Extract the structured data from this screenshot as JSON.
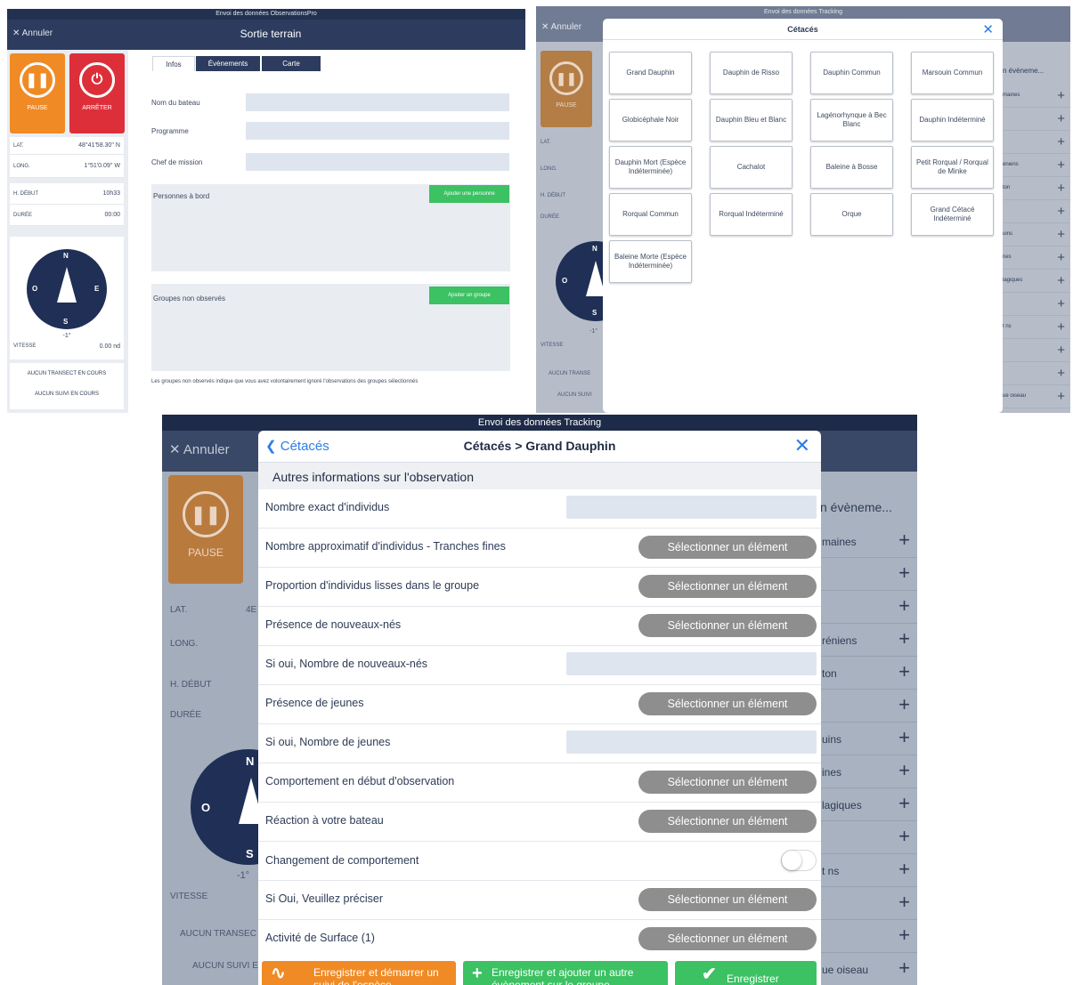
{
  "shot1": {
    "topbar": "Envoi des données ObservationsPro",
    "cancel": "Annuler",
    "title": "Sortie terrain",
    "pause": "PAUSE",
    "stop": "ARRÊTER",
    "info": [
      {
        "k": "LAT.",
        "v": "48°41'58.30'' N"
      },
      {
        "k": "LONG.",
        "v": "1°51'0.09'' W"
      },
      {
        "k": "H. DÉBUT",
        "v": "10h33"
      },
      {
        "k": "DURÉE",
        "v": "00:00"
      }
    ],
    "compass": {
      "n": "N",
      "o": "O",
      "e": "E",
      "s": "S",
      "heading": "-1°"
    },
    "speed": {
      "k": "VITESSE",
      "v": "0.00 nd"
    },
    "transect": "AUCUN TRANSECT EN COURS",
    "suivi": "AUCUN SUIVI EN COURS",
    "tabs": [
      "Infos",
      "Évènements",
      "Carte"
    ],
    "fields": [
      "Nom du bateau",
      "Programme",
      "Chef de mission"
    ],
    "persons": "Personnes à bord",
    "add_person": "Ajouter une personne",
    "groups": "Groupes non observés",
    "add_group": "Ajouter un groupe",
    "note": "Les groupes non observés indique que vous avez volontairement ignoré l'observations des groupes sélectionnés"
  },
  "shot2": {
    "topbar": "Envoi des données Tracking",
    "cancel": "Annuler",
    "pause": "PAUSE",
    "left_labels": [
      "LAT.",
      "LONG.",
      "H. DÉBUT",
      "DURÉE"
    ],
    "speed": "VITESSE",
    "transect": "AUCUN TRANSE",
    "suivi": "AUCUN SUIVI",
    "heading": "-1°",
    "n": "N",
    "o": "O",
    "s": "S",
    "modal_title": "Cétacés",
    "cells": [
      "Grand Dauphin",
      "Dauphin de Risso",
      "Dauphin Commun",
      "Marsouin Commun",
      "Globicéphale Noir",
      "Dauphin Bleu et Blanc",
      "Lagénorhynque à Bec Blanc",
      "Dauphin Indéterminé",
      "Dauphin Mort (Espèce Indéterminée)",
      "Cachalot",
      "Baleine à Bosse",
      "Petit Rorqual / Rorqual de Minke",
      "Rorqual Commun",
      "Rorqual Indéterminé",
      "Orque",
      "Grand Cétacé Indéterminé",
      "Baleine Morte (Espèce Indéterminée)"
    ],
    "right_header": "n évèneme...",
    "right_items": [
      "maines",
      "",
      "",
      "éniens",
      "ton",
      "",
      "uins",
      "nes",
      "lagiques",
      "",
      "t ns",
      "",
      "",
      "ue oiseau"
    ]
  },
  "shot3": {
    "topbar": "Envoi des données Tracking",
    "cancel": "Annuler",
    "pause": "PAUSE",
    "left_labels": [
      "LAT.",
      "LONG.",
      "H. DÉBUT",
      "DURÉE"
    ],
    "lat_partial": "4E",
    "heading": "-1°",
    "n": "N",
    "o": "O",
    "s": "S",
    "speed": "VITESSE",
    "transect": "AUCUN TRANSEC",
    "suivi": "AUCUN SUIVI E",
    "back": "Cétacés",
    "title": "Cétacés > Grand Dauphin",
    "section": "Autres informations sur l'observation",
    "select_label": "Sélectionner un élément",
    "rows": [
      {
        "label": "Nombre exact d'individus",
        "type": "input"
      },
      {
        "label": "Nombre approximatif d'individus - Tranches fines",
        "type": "select"
      },
      {
        "label": "Proportion d'individus lisses dans le groupe",
        "type": "select"
      },
      {
        "label": "Présence de nouveaux-nés",
        "type": "select"
      },
      {
        "label": "Si oui, Nombre de nouveaux-nés",
        "type": "input"
      },
      {
        "label": "Présence de jeunes",
        "type": "select"
      },
      {
        "label": "Si oui, Nombre de jeunes",
        "type": "input"
      },
      {
        "label": "Comportement en début d'observation",
        "type": "select"
      },
      {
        "label": "Réaction à votre bateau",
        "type": "select"
      },
      {
        "label": "Changement de comportement",
        "type": "toggle"
      },
      {
        "label": "Si Oui, Veuillez préciser",
        "type": "select"
      },
      {
        "label": "Activité de Surface (1)",
        "type": "select"
      }
    ],
    "btn_follow": "Enregistrer et démarrer un suivi de l'espèce",
    "btn_add": "Enregistrer et ajouter un autre évènement sur le groupe",
    "btn_save": "Enregistrer",
    "right_header": "n évèneme...",
    "right_items": [
      "maines",
      "",
      "",
      "réniens",
      "ton",
      "",
      "uins",
      "ines",
      "lagiques",
      "",
      "t ns",
      "",
      "",
      "ue oiseau"
    ]
  },
  "colors": {
    "navy": "#2d3c5e",
    "orange": "#f08a24",
    "red": "#dd2f3a",
    "green": "#3cc163",
    "blue": "#2b7de9",
    "select_gray": "#8e8e8e"
  }
}
